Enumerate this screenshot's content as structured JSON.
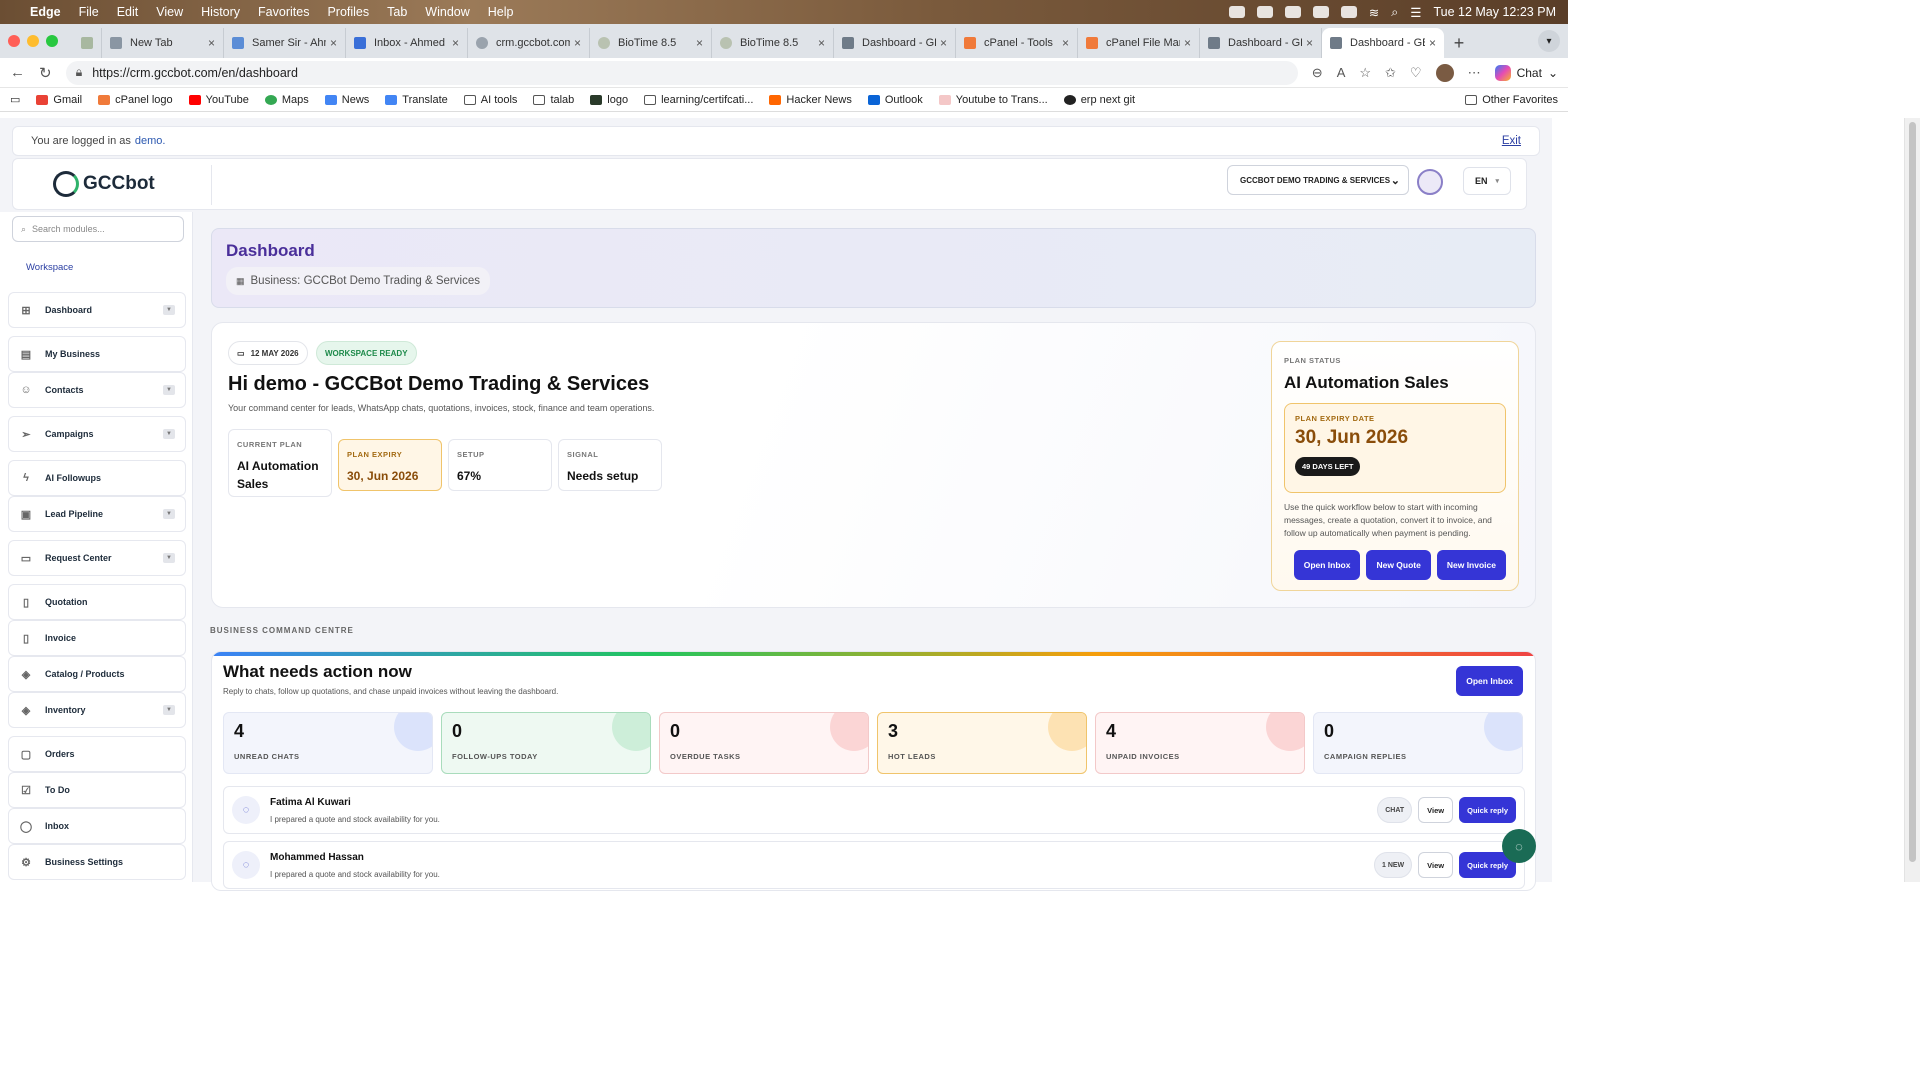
{
  "mac_menu": {
    "app": "Edge",
    "items": [
      "File",
      "Edit",
      "View",
      "History",
      "Favorites",
      "Profiles",
      "Tab",
      "Window",
      "Help"
    ],
    "clock": "Tue 12 May  12:23 PM"
  },
  "tabs": [
    {
      "title": ""
    },
    {
      "title": "New Tab"
    },
    {
      "title": "Samer Sir - Ahm"
    },
    {
      "title": "Inbox - Ahmed S"
    },
    {
      "title": "crm.gccbot.com"
    },
    {
      "title": "BioTime 8.5"
    },
    {
      "title": "BioTime 8.5"
    },
    {
      "title": "Dashboard - GB"
    },
    {
      "title": "cPanel - Tools"
    },
    {
      "title": "cPanel File Mana"
    },
    {
      "title": "Dashboard - GB"
    },
    {
      "title": "Dashboard - GB"
    }
  ],
  "address": {
    "url": "https://crm.gccbot.com/en/dashboard",
    "chat_label": "Chat"
  },
  "bookmarks": [
    "Gmail",
    "cPanel logo",
    "YouTube",
    "Maps",
    "News",
    "Translate",
    "AI tools",
    "talab",
    "logo",
    "learning/certifcati...",
    "Hacker News",
    "Outlook",
    "Youtube to Trans...",
    "erp next git"
  ],
  "other_favorites": "Other Favorites",
  "login": {
    "prefix": "You are logged in as",
    "user": "demo.",
    "exit": "Exit"
  },
  "header": {
    "logo": "GCCbot",
    "business_select": "GCCBOT DEMO TRADING & SERVICES",
    "lang": "EN"
  },
  "sidebar": {
    "search_placeholder": "Search modules...",
    "section": "Workspace",
    "items": [
      {
        "label": "Dashboard",
        "icon": "grid-icon",
        "chev": true
      },
      {
        "label": "My Business",
        "icon": "building-icon",
        "chev": false
      },
      {
        "label": "Contacts",
        "icon": "users-icon",
        "chev": true
      },
      {
        "label": "Campaigns",
        "icon": "send-icon",
        "chev": true
      },
      {
        "label": "AI Followups",
        "icon": "bolt-icon",
        "chev": false
      },
      {
        "label": "Lead Pipeline",
        "icon": "briefcase-icon",
        "chev": true
      },
      {
        "label": "Request Center",
        "icon": "inbox-icon",
        "chev": true
      },
      {
        "label": "Quotation",
        "icon": "file-plus-icon",
        "chev": false
      },
      {
        "label": "Invoice",
        "icon": "file-text-icon",
        "chev": false
      },
      {
        "label": "Catalog / Products",
        "icon": "box-icon",
        "chev": false
      },
      {
        "label": "Inventory",
        "icon": "package-icon",
        "chev": true
      },
      {
        "label": "Orders",
        "icon": "orders-icon",
        "chev": false
      },
      {
        "label": "To Do",
        "icon": "check-square-icon",
        "chev": false
      },
      {
        "label": "Inbox",
        "icon": "whatsapp-icon",
        "chev": false
      },
      {
        "label": "Business Settings",
        "icon": "gear-icon",
        "chev": false
      }
    ]
  },
  "dashboard": {
    "title": "Dashboard",
    "business": "Business: GCCBot Demo Trading & Services"
  },
  "hero": {
    "date": "12 MAY 2026",
    "status": "WORKSPACE READY",
    "greeting": "Hi demo - GCCBot Demo Trading & Services",
    "subtitle": "Your command center for leads, WhatsApp chats, quotations, invoices, stock, finance and team operations.",
    "stats": [
      {
        "key": "CURRENT PLAN",
        "value": "AI Automation Sales"
      },
      {
        "key": "PLAN EXPIRY",
        "value": "30, Jun 2026"
      },
      {
        "key": "SETUP",
        "value": "67%"
      },
      {
        "key": "SIGNAL",
        "value": "Needs setup"
      }
    ]
  },
  "plan": {
    "label": "PLAN STATUS",
    "name": "AI Automation Sales",
    "expiry_label": "PLAN EXPIRY DATE",
    "expiry_date": "30, Jun 2026",
    "days_left": "49 DAYS LEFT",
    "description": "Use the quick workflow below to start with incoming messages, create a quotation, convert it to invoice, and follow up automatically when payment is pending.",
    "buttons": [
      "Open Inbox",
      "New Quote",
      "New Invoice"
    ]
  },
  "section_label": "BUSINESS COMMAND CENTRE",
  "action": {
    "title": "What needs action now",
    "subtitle": "Reply to chats, follow up quotations, and chase unpaid invoices without leaving the dashboard.",
    "open_inbox": "Open Inbox",
    "kpis": [
      {
        "value": "4",
        "label": "UNREAD CHATS",
        "color": "#dbe3fb"
      },
      {
        "value": "0",
        "label": "FOLLOW-UPS TODAY",
        "color": "#cdeed9"
      },
      {
        "value": "0",
        "label": "OVERDUE TASKS",
        "color": "#fbd5d5"
      },
      {
        "value": "3",
        "label": "HOT LEADS",
        "color": "#fde2b3"
      },
      {
        "value": "4",
        "label": "UNPAID INVOICES",
        "color": "#fbd5d5"
      },
      {
        "value": "0",
        "label": "CAMPAIGN REPLIES",
        "color": "#dbe3fb"
      }
    ],
    "rows": [
      {
        "name": "Fatima Al Kuwari",
        "message": "I prepared a quote and stock availability for you.",
        "tag": "CHAT",
        "view": "View",
        "reply": "Quick reply"
      },
      {
        "name": "Mohammed Hassan",
        "message": "I prepared a quote and stock availability for you.",
        "tag": "1 NEW",
        "view": "View",
        "reply": "Quick reply"
      }
    ]
  },
  "colors": {
    "primary": "#3535d6",
    "dashboard_title": "#4a2f9a",
    "expiry": "#8a4d0a"
  }
}
